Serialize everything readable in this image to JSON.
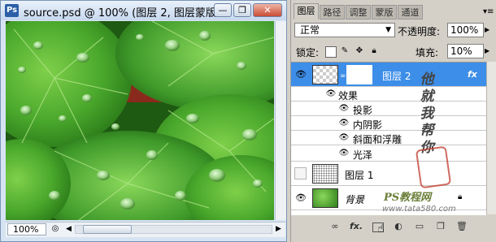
{
  "document_window": {
    "app_icon_label": "Ps",
    "title": "source.psd @ 100% (图层 2, 图层蒙版/...",
    "minimize_label": "—",
    "restore_label": "❐",
    "close_label": "✕",
    "zoom_value": "100%",
    "scroll_left_label": "◀",
    "scroll_right_label": "▶"
  },
  "layers_panel": {
    "tabs": [
      {
        "label": "图层",
        "active": true
      },
      {
        "label": "路径",
        "active": false
      },
      {
        "label": "调整",
        "active": false
      },
      {
        "label": "蒙版",
        "active": false
      },
      {
        "label": "通道",
        "active": false
      }
    ],
    "menu_label": "▾≡",
    "blend_mode": "正常",
    "opacity_label": "不透明度:",
    "opacity_value": "100%",
    "lock_label": "锁定:",
    "lock_icons": [
      "transparency-lock-icon",
      "brush-lock-icon",
      "move-lock-icon",
      "all-lock-icon"
    ],
    "fill_label": "填充:",
    "fill_value": "10%",
    "layers": [
      {
        "name": "图层 2",
        "selected": true,
        "visible": true,
        "has_fx": true,
        "fx_label": "fx"
      },
      {
        "name": "图层 1",
        "selected": false,
        "visible": false
      },
      {
        "name": "背景",
        "selected": false,
        "visible": true,
        "locked": true
      }
    ],
    "effects_label": "效果",
    "effects": [
      "投影",
      "内阴影",
      "斜面和浮雕",
      "光泽"
    ],
    "bottom_icons": [
      "link-icon",
      "fx-icon",
      "mask-icon",
      "adjustment-icon",
      "group-icon",
      "new-layer-icon",
      "trash-icon"
    ]
  },
  "watermark": {
    "vertical_text": "他 就 我 帮 你",
    "site_text": "PS教程网",
    "url_text": "www.tata580.com"
  },
  "colors": {
    "selected_layer": "#3d8ee8",
    "title_gradient_top": "#e9f1fb",
    "title_gradient_bottom": "#c7d9ef",
    "leaf_green": "#3f9a2a"
  }
}
